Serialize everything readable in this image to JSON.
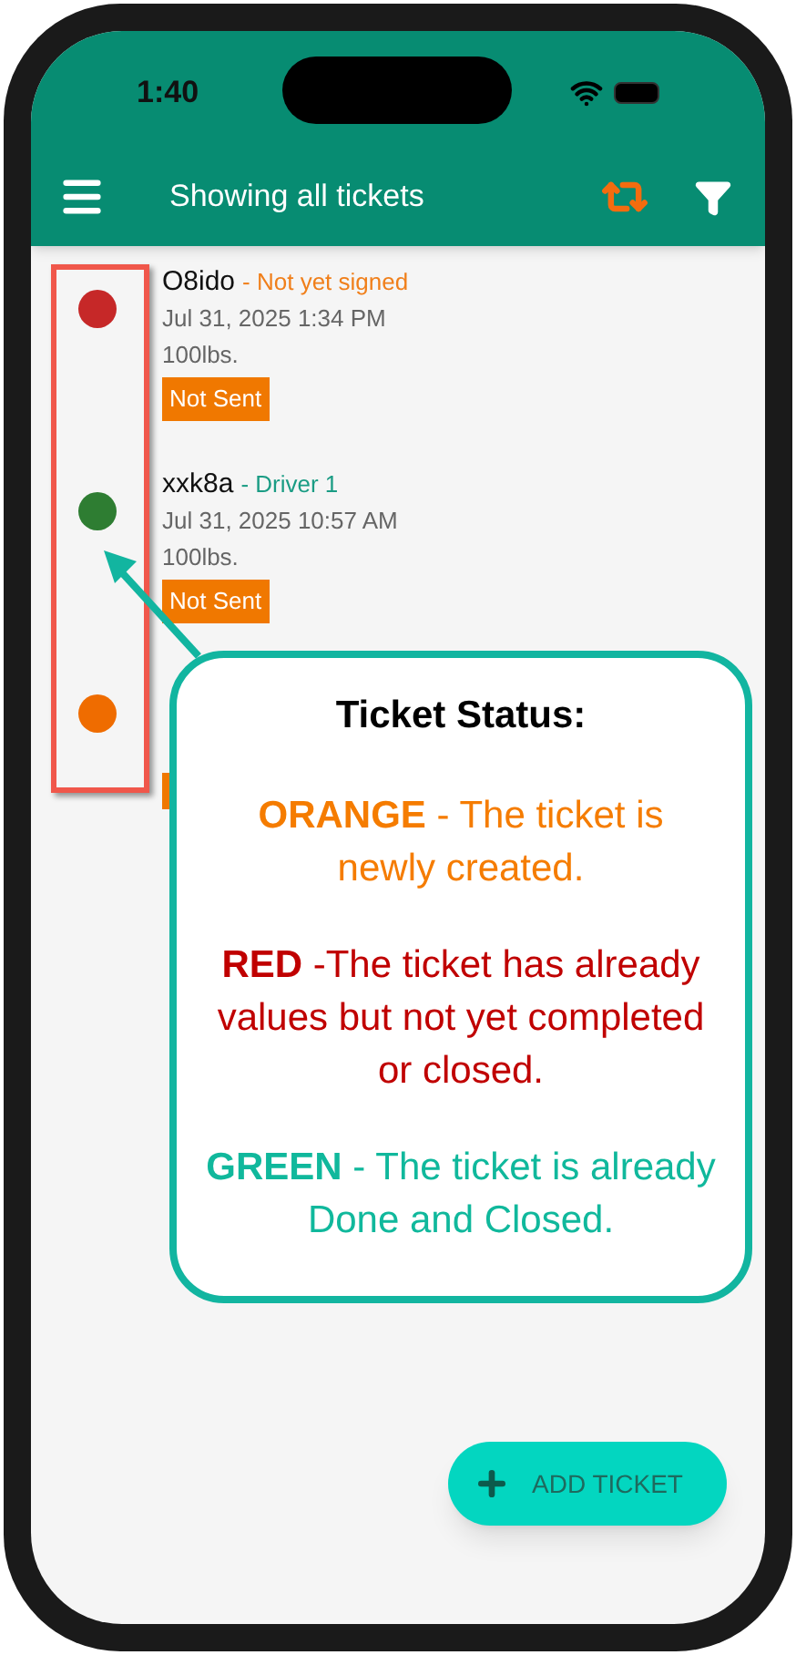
{
  "status_bar": {
    "time": "1:40"
  },
  "toolbar": {
    "title": "Showing all tickets"
  },
  "tickets": [
    {
      "color": "#c62828",
      "name": "O8ido",
      "note": {
        "text": "- Not yet signed",
        "color": "#f07f1a"
      },
      "date": "Jul 31, 2025 1:34 PM",
      "weight": "100lbs.",
      "badge": "Not Sent"
    },
    {
      "color": "#2e7d32",
      "name": "xxk8a",
      "note": {
        "text": "- Driver 1",
        "color": "#1a9c84"
      },
      "date": "Jul 31, 2025 10:57 AM",
      "weight": "100lbs.",
      "badge": "Not Sent"
    },
    {
      "color": "#ef6c00",
      "badge_hidden": true
    }
  ],
  "callout": {
    "title": "Ticket Status:",
    "entries": [
      {
        "text": "**ORANGE** - The ticket is newly created.",
        "color": "#f57c00"
      },
      {
        "text": "**RED** -The ticket has already values but not yet completed or closed.",
        "color": "#c00000"
      },
      {
        "text": "**GREEN** - The ticket is already Done and Closed.",
        "color": "#10b89c"
      }
    ]
  },
  "fab": {
    "label": "ADD TICKET"
  }
}
